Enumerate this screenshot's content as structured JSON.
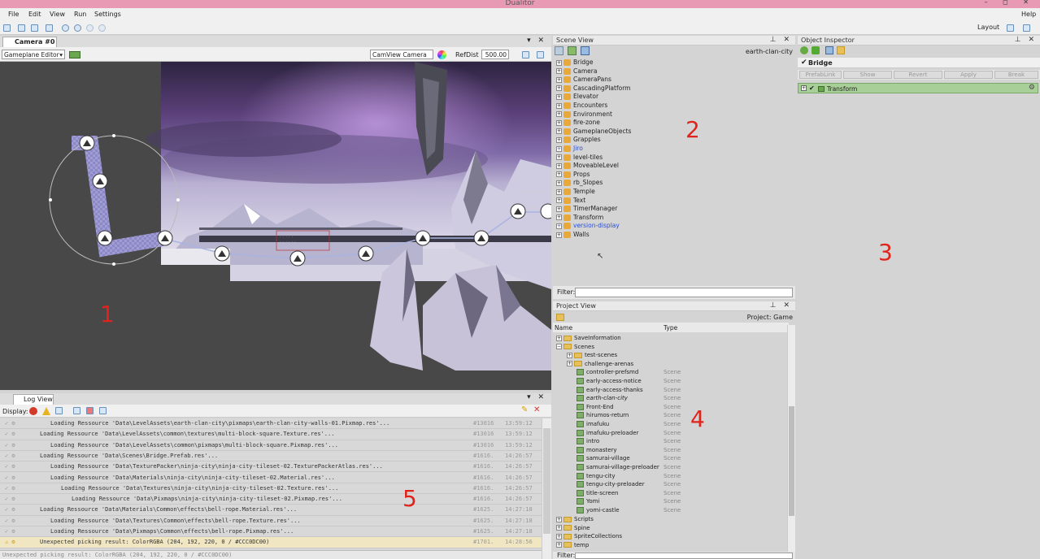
{
  "app": {
    "title": "Dualitor",
    "window_controls": "– ◻ ✕"
  },
  "menu": [
    "File",
    "Edit",
    "View",
    "Run",
    "Settings"
  ],
  "menu_right": "Help",
  "toolbar": {
    "layout_label": "Layout"
  },
  "camera_panel": {
    "tab": "Camera #0",
    "editor_mode": "Gameplane Editor",
    "view_mode": "CamView Camera",
    "refdist_label": "RefDist",
    "refdist_value": "500.00",
    "annotation": "1"
  },
  "scene_view": {
    "title": "Scene View",
    "scene_name": "earth-clan-city",
    "filter_label": "Filter:",
    "annotation": "2",
    "items": [
      {
        "name": "Bridge",
        "prefab": false
      },
      {
        "name": "Camera",
        "prefab": false
      },
      {
        "name": "CameraPans",
        "prefab": false
      },
      {
        "name": "CascadingPlatform",
        "prefab": false
      },
      {
        "name": "Elevator",
        "prefab": false
      },
      {
        "name": "Encounters",
        "prefab": false
      },
      {
        "name": "Environment",
        "prefab": false
      },
      {
        "name": "fire-zone",
        "prefab": false
      },
      {
        "name": "GameplaneObjects",
        "prefab": false
      },
      {
        "name": "Grapples",
        "prefab": false
      },
      {
        "name": "Jiro",
        "prefab": true
      },
      {
        "name": "level-tiles",
        "prefab": false
      },
      {
        "name": "MoveableLevel",
        "prefab": false
      },
      {
        "name": "Props",
        "prefab": false
      },
      {
        "name": "rb_Slopes",
        "prefab": false
      },
      {
        "name": "Temple",
        "prefab": false
      },
      {
        "name": "Text",
        "prefab": false
      },
      {
        "name": "TimerManager",
        "prefab": false
      },
      {
        "name": "Transform",
        "prefab": false
      },
      {
        "name": "version-display",
        "prefab": true
      },
      {
        "name": "Walls",
        "prefab": false
      }
    ]
  },
  "object_inspector": {
    "title": "Object Inspector",
    "object_name": "Bridge",
    "prefab_buttons": [
      "PrefabLink",
      "Show",
      "Revert",
      "Apply",
      "Break"
    ],
    "component": "Transform",
    "annotation": "3"
  },
  "project_view": {
    "title": "Project View",
    "project_label": "Project: Game",
    "col_name": "Name",
    "col_type": "Type",
    "filter_label": "Filter:",
    "annotation": "4",
    "items": [
      {
        "name": "SaveInformation",
        "kind": "folder",
        "level": 0,
        "type": ""
      },
      {
        "name": "Scenes",
        "kind": "folder",
        "level": 0,
        "type": ""
      },
      {
        "name": "test-scenes",
        "kind": "folder",
        "level": 1,
        "type": ""
      },
      {
        "name": "challenge-arenas",
        "kind": "folder",
        "level": 1,
        "type": ""
      },
      {
        "name": "controller-prefsmd",
        "kind": "scene",
        "level": 1,
        "type": "Scene"
      },
      {
        "name": "early-access-notice",
        "kind": "scene",
        "level": 1,
        "type": "Scene"
      },
      {
        "name": "early-access-thanks",
        "kind": "scene",
        "level": 1,
        "type": "Scene"
      },
      {
        "name": "earth-clan-city",
        "kind": "scene",
        "level": 1,
        "type": "Scene",
        "italic": true
      },
      {
        "name": "Front-End",
        "kind": "scene",
        "level": 1,
        "type": "Scene"
      },
      {
        "name": "hirumos-return",
        "kind": "scene",
        "level": 1,
        "type": "Scene"
      },
      {
        "name": "imafuku",
        "kind": "scene",
        "level": 1,
        "type": "Scene"
      },
      {
        "name": "imafuku-preloader",
        "kind": "scene",
        "level": 1,
        "type": "Scene"
      },
      {
        "name": "intro",
        "kind": "scene",
        "level": 1,
        "type": "Scene"
      },
      {
        "name": "monastery",
        "kind": "scene",
        "level": 1,
        "type": "Scene"
      },
      {
        "name": "samurai-village",
        "kind": "scene",
        "level": 1,
        "type": "Scene"
      },
      {
        "name": "samurai-village-preloader",
        "kind": "scene",
        "level": 1,
        "type": "Scene"
      },
      {
        "name": "tengu-city",
        "kind": "scene",
        "level": 1,
        "type": "Scene"
      },
      {
        "name": "tengu-city-preloader",
        "kind": "scene",
        "level": 1,
        "type": "Scene"
      },
      {
        "name": "title-screen",
        "kind": "scene",
        "level": 1,
        "type": "Scene"
      },
      {
        "name": "Yomi",
        "kind": "scene",
        "level": 1,
        "type": "Scene"
      },
      {
        "name": "yomi-castle",
        "kind": "scene",
        "level": 1,
        "type": "Scene"
      },
      {
        "name": "Scripts",
        "kind": "folder",
        "level": 0,
        "type": ""
      },
      {
        "name": "Spine",
        "kind": "folder",
        "level": 0,
        "type": ""
      },
      {
        "name": "SpriteCollections",
        "kind": "folder",
        "level": 0,
        "type": ""
      },
      {
        "name": "temp",
        "kind": "folder",
        "level": 0,
        "type": ""
      }
    ]
  },
  "log_view": {
    "title": "Log View",
    "display_label": "Display:",
    "annotation": "5",
    "rows": [
      {
        "msg": "Loading Ressource 'Data\\LevelAssets\\earth-clan-city\\pixmaps\\earth-clan-city-walls-01.Pixmap.res'...",
        "indent": 62,
        "num": "#13016",
        "time": "13:59:12",
        "warn": false
      },
      {
        "msg": "Loading Ressource 'Data\\LevelAssets\\common\\textures\\multi-block-square.Texture.res'...",
        "indent": 49,
        "num": "#13016",
        "time": "13:59:12",
        "warn": false
      },
      {
        "msg": "Loading Ressource 'Data\\LevelAssets\\common\\pixmaps\\multi-block-square.Pixmap.res'...",
        "indent": 62,
        "num": "#13016",
        "time": "13:59:12",
        "warn": false
      },
      {
        "msg": "Loading Ressource 'Data\\Scenes\\Bridge.Prefab.res'...",
        "indent": 49,
        "num": "#1616.",
        "time": "14:26:57",
        "warn": false
      },
      {
        "msg": "Loading Ressource 'Data\\TexturePacker\\ninja-city\\ninja-city-tileset-02.TexturePackerAtlas.res'...",
        "indent": 62,
        "num": "#1616.",
        "time": "14:26:57",
        "warn": false
      },
      {
        "msg": "Loading Ressource 'Data\\Materials\\ninja-city\\ninja-city-tileset-02.Material.res'...",
        "indent": 62,
        "num": "#1616.",
        "time": "14:26:57",
        "warn": false
      },
      {
        "msg": "Loading Ressource 'Data\\Textures\\ninja-city\\ninja-city-tileset-02.Texture.res'...",
        "indent": 75,
        "num": "#1616.",
        "time": "14:26:57",
        "warn": false
      },
      {
        "msg": "Loading Ressource 'Data\\Pixmaps\\ninja-city\\ninja-city-tileset-02.Pixmap.res'...",
        "indent": 88,
        "num": "#1616.",
        "time": "14:26:57",
        "warn": false
      },
      {
        "msg": "Loading Ressource 'Data\\Materials\\Common\\effects\\bell-rope.Material.res'...",
        "indent": 49,
        "num": "#1625.",
        "time": "14:27:18",
        "warn": false
      },
      {
        "msg": "Loading Ressource 'Data\\Textures\\Common\\effects\\bell-rope.Texture.res'...",
        "indent": 62,
        "num": "#1625.",
        "time": "14:27:18",
        "warn": false
      },
      {
        "msg": "Loading Ressource 'Data\\Pixmaps\\Common\\effects\\bell-rope.Pixmap.res'...",
        "indent": 62,
        "num": "#1625.",
        "time": "14:27:18",
        "warn": false
      },
      {
        "msg": "Unexpected picking result: ColorRGBA (204, 192, 220, 0 / #CCC0DC00)",
        "indent": 49,
        "num": "#1701.",
        "time": "14:28:56",
        "warn": true
      }
    ],
    "status": "Unexpected picking result: ColorRGBA (204, 192, 220, 0 / #CCC0DC00)"
  }
}
